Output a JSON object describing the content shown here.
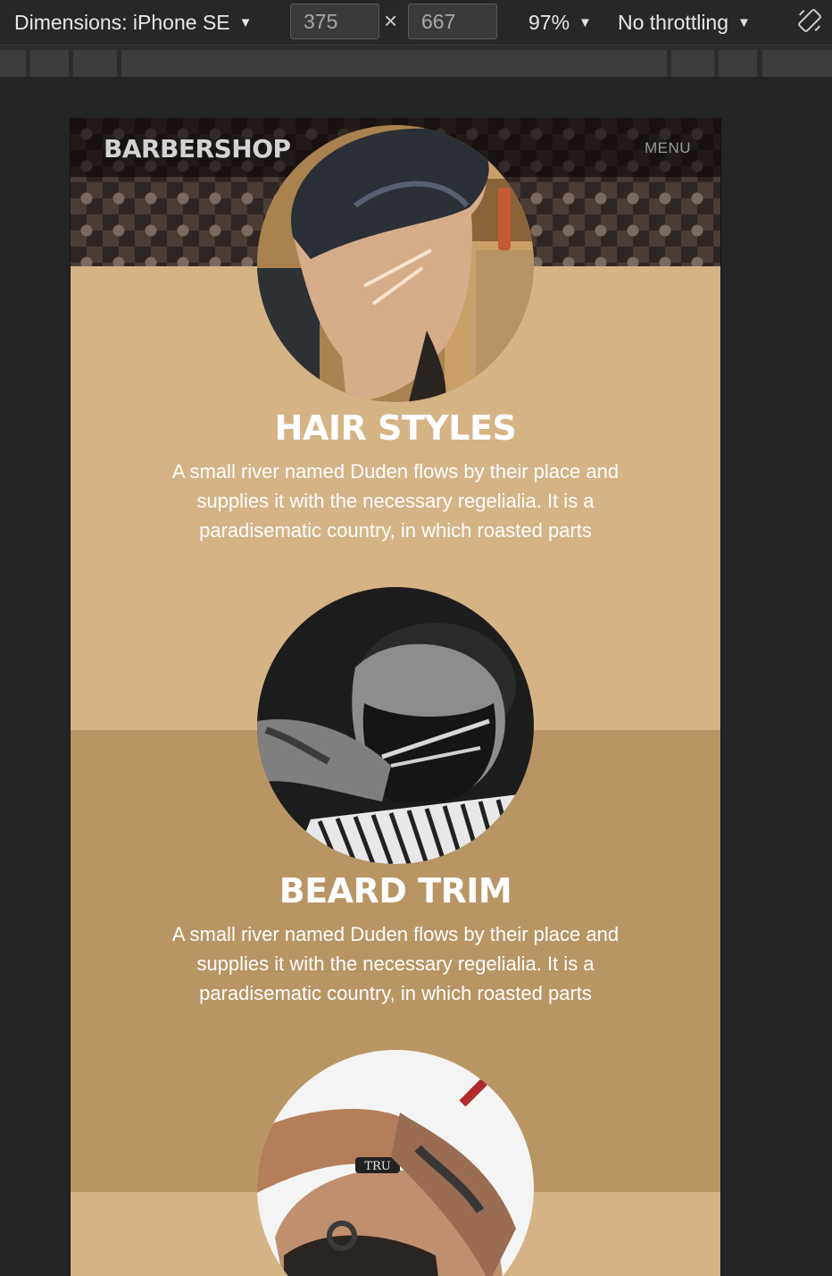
{
  "devtools": {
    "device_label": "Dimensions: iPhone SE",
    "width_value": "375",
    "times": "×",
    "height_value": "667",
    "zoom_label": "97%",
    "throttle_label": "No throttling",
    "caret": "▼"
  },
  "site": {
    "brand": "BARBERSHOP",
    "menu": "MENU"
  },
  "services": [
    {
      "title": "HAIR STYLES",
      "text": "A small river named Duden flows by their place and supplies it with the necessary regelialia. It is a paradisematic country, in which roasted parts"
    },
    {
      "title": "BEARD TRIM",
      "text": "A small river named Duden flows by their place and supplies it with the necessary regelialia. It is a paradisematic country, in which roasted parts"
    },
    {
      "title": "",
      "text": "",
      "image_text": "TRU"
    }
  ],
  "colors": {
    "light_band": "#d5b385",
    "dark_band": "#b99564",
    "devtools_bg": "#272727"
  },
  "icons": [
    "caret-down-icon",
    "rotate-device-icon"
  ]
}
